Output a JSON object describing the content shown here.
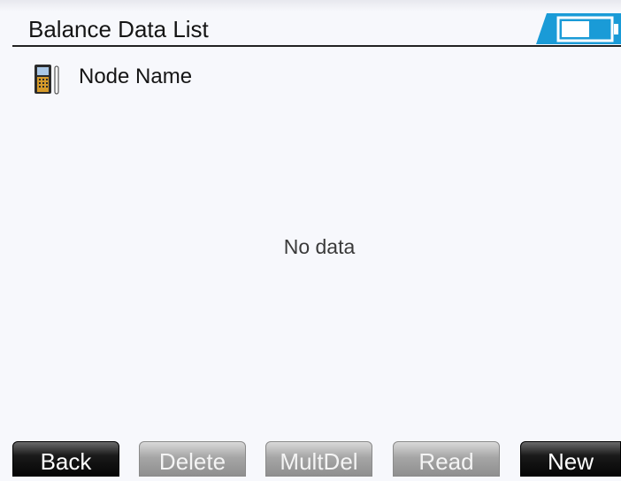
{
  "header": {
    "title": "Balance Data List",
    "battery_icon": "battery-icon"
  },
  "list": {
    "column_label": "Node Name",
    "column_icon": "device-meter-icon",
    "empty_text": "No data"
  },
  "buttons": [
    {
      "label": "Back",
      "enabled": true
    },
    {
      "label": "Delete",
      "enabled": false
    },
    {
      "label": "MultDel",
      "enabled": false
    },
    {
      "label": "Read",
      "enabled": false
    },
    {
      "label": "New",
      "enabled": true
    }
  ],
  "colors": {
    "background": "#f7f8fc",
    "battery_accent": "#1a9bd7",
    "button_active": "#050505",
    "button_disabled": "#a6a6a6"
  }
}
